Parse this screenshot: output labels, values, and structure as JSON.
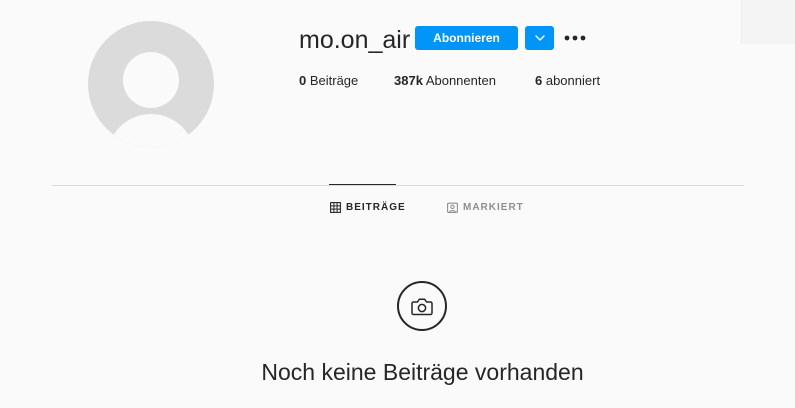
{
  "profile": {
    "username": "mo.on_air",
    "follow_label": "Abonnieren",
    "stats": {
      "posts_count": "0",
      "posts_label": " Beiträge",
      "followers_count": "387k",
      "followers_label": " Abonnenten",
      "following_count": "6",
      "following_label": " abonniert"
    }
  },
  "tabs": [
    {
      "label": "BEITRÄGE",
      "icon": "grid-icon",
      "active": true
    },
    {
      "label": "MARKIERT",
      "icon": "tagged-icon",
      "active": false
    }
  ],
  "empty_state": {
    "icon": "camera-icon",
    "message": "Noch keine Beiträge vorhanden"
  },
  "colors": {
    "accent": "#0095f6",
    "text": "#262626",
    "muted": "#8e8e8e",
    "background": "#fafafa",
    "divider": "#dbdbdb"
  }
}
